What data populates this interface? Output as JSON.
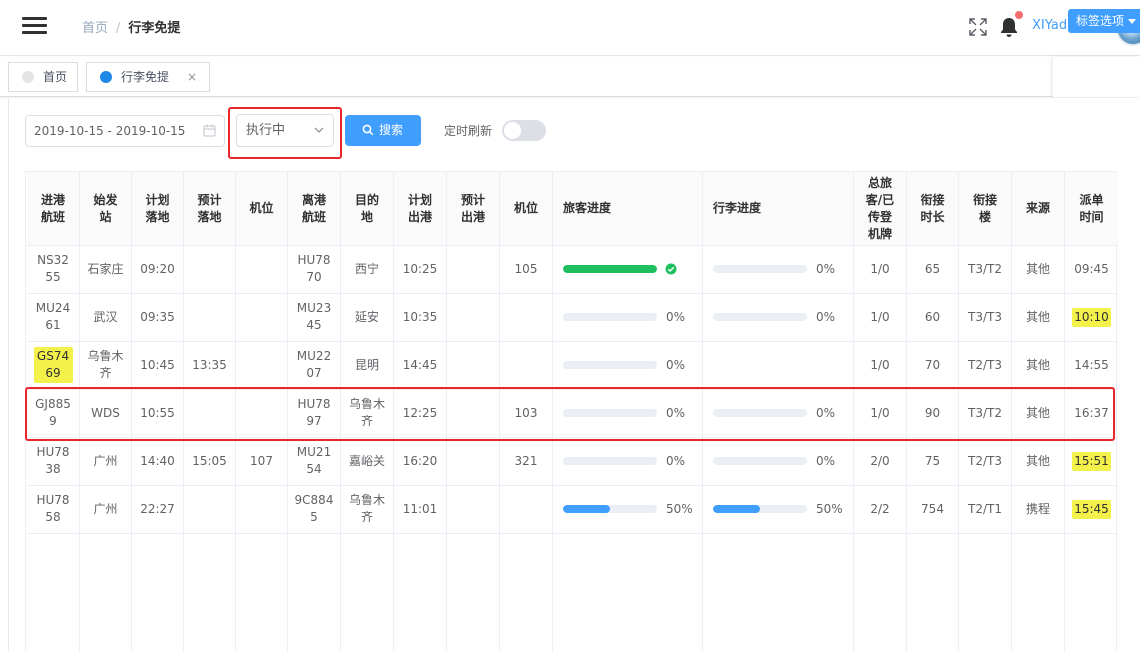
{
  "header": {
    "breadcrumb": {
      "home": "首页",
      "separator": "/",
      "current": "行李免提"
    },
    "username": "XIYad...",
    "icons": [
      "menu-icon",
      "fullscreen-icon",
      "bell-icon",
      "avatar"
    ]
  },
  "tags": {
    "items": [
      {
        "label": "首页",
        "active": false
      },
      {
        "label": "行李免提",
        "active": true,
        "close": "×"
      }
    ],
    "options_label": "标签选项"
  },
  "filters": {
    "date_range": "2019-10-15 - 2019-10-15",
    "status_value": "执行中",
    "search_label": "搜索",
    "refresh_label": "定时刷新",
    "refresh_on": false
  },
  "colors": {
    "primary": "#409eff",
    "success": "#1fbf5f",
    "highlight": "#f3f14a",
    "annotation": "#e8262b"
  },
  "table": {
    "headers": [
      "进港航班",
      "始发站",
      "计划落地",
      "预计落地",
      "机位",
      "离港航班",
      "目的地",
      "计划出港",
      "预计出港",
      "机位",
      "旅客进度",
      "行李进度",
      "总旅客/已传登机牌",
      "衔接时长",
      "衔接楼",
      "来源",
      "派单时间"
    ],
    "rows": [
      {
        "in_flight": "NS3255",
        "origin": "石家庄",
        "plan_land": "09:20",
        "est_land": "",
        "in_stand": "",
        "out_flight": "HU7870",
        "dest": "西宁",
        "plan_dep": "10:25",
        "est_dep": "",
        "out_stand": "105",
        "pax_progress": 100,
        "pax_label": "",
        "bag_progress": 0,
        "bag_label": "0%",
        "pax_board": "1/0",
        "conn_time": "65",
        "conn_term": "T3/T2",
        "source": "其他",
        "dispatch": "09:45",
        "hl_in": false,
        "hl_dispatch": false
      },
      {
        "in_flight": "MU2461",
        "origin": "武汉",
        "plan_land": "09:35",
        "est_land": "",
        "in_stand": "",
        "out_flight": "MU2345",
        "dest": "延安",
        "plan_dep": "10:35",
        "est_dep": "",
        "out_stand": "",
        "pax_progress": 0,
        "pax_label": "0%",
        "bag_progress": 0,
        "bag_label": "0%",
        "pax_board": "1/0",
        "conn_time": "60",
        "conn_term": "T3/T3",
        "source": "其他",
        "dispatch": "10:10",
        "hl_in": false,
        "hl_dispatch": true
      },
      {
        "in_flight": "GS7469",
        "origin": "乌鲁木齐",
        "plan_land": "10:45",
        "est_land": "13:35",
        "in_stand": "",
        "out_flight": "MU2207",
        "dest": "昆明",
        "plan_dep": "14:45",
        "est_dep": "",
        "out_stand": "",
        "pax_progress": 0,
        "pax_label": "0%",
        "bag_progress": null,
        "bag_label": "",
        "pax_board": "1/0",
        "conn_time": "70",
        "conn_term": "T2/T3",
        "source": "其他",
        "dispatch": "14:55",
        "hl_in": true,
        "hl_dispatch": false
      },
      {
        "in_flight": "GJ8859",
        "origin": "WDS",
        "plan_land": "10:55",
        "est_land": "",
        "in_stand": "",
        "out_flight": "HU7897",
        "dest": "乌鲁木齐",
        "plan_dep": "12:25",
        "est_dep": "",
        "out_stand": "103",
        "pax_progress": 0,
        "pax_label": "0%",
        "bag_progress": 0,
        "bag_label": "0%",
        "pax_board": "1/0",
        "conn_time": "90",
        "conn_term": "T3/T2",
        "source": "其他",
        "dispatch": "16:37",
        "hl_in": false,
        "hl_dispatch": false
      },
      {
        "in_flight": "HU7838",
        "origin": "广州",
        "plan_land": "14:40",
        "est_land": "15:05",
        "in_stand": "107",
        "out_flight": "MU2154",
        "dest": "嘉峪关",
        "plan_dep": "16:20",
        "est_dep": "",
        "out_stand": "321",
        "pax_progress": 0,
        "pax_label": "0%",
        "bag_progress": 0,
        "bag_label": "0%",
        "pax_board": "2/0",
        "conn_time": "75",
        "conn_term": "T2/T3",
        "source": "其他",
        "dispatch": "15:51",
        "hl_in": false,
        "hl_dispatch": true
      },
      {
        "in_flight": "HU7858",
        "origin": "广州",
        "plan_land": "22:27",
        "est_land": "",
        "in_stand": "",
        "out_flight": "9C8845",
        "dest": "乌鲁木齐",
        "plan_dep": "11:01",
        "est_dep": "",
        "out_stand": "",
        "pax_progress": 50,
        "pax_label": "50%",
        "bag_progress": 50,
        "bag_label": "50%",
        "pax_board": "2/2",
        "conn_time": "754",
        "conn_term": "T2/T1",
        "source": "携程",
        "dispatch": "15:45",
        "hl_in": false,
        "hl_dispatch": true
      }
    ]
  }
}
